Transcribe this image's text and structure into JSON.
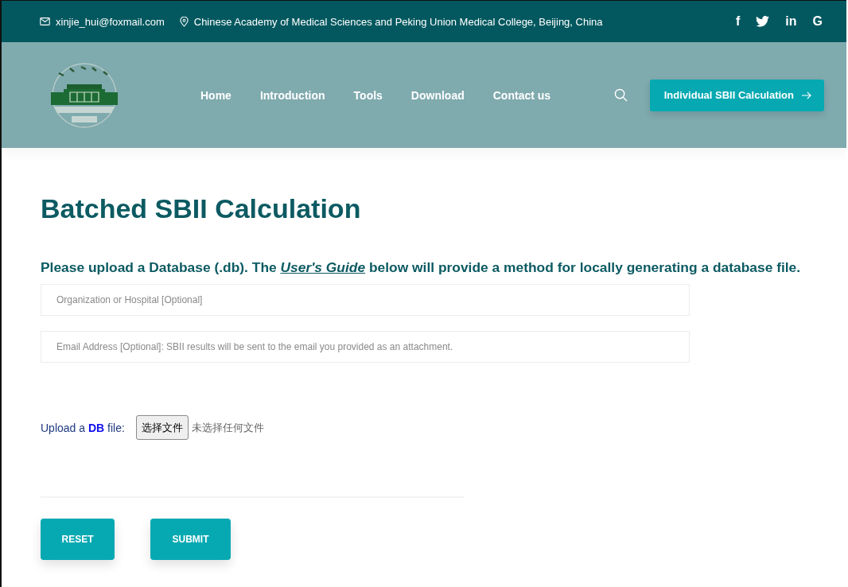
{
  "top_bar": {
    "email": "xinjie_hui@foxmail.com",
    "address": "Chinese Academy of Medical Sciences and Peking Union Medical College, Beijing, China",
    "social": [
      {
        "kind": "text",
        "label": "f"
      },
      {
        "kind": "bird"
      },
      {
        "kind": "text",
        "label": "in"
      },
      {
        "kind": "text",
        "label": "G"
      }
    ]
  },
  "nav": {
    "items": [
      "Home",
      "Introduction",
      "Tools",
      "Download",
      "Contact us"
    ],
    "cta": "Individual SBII Calculation"
  },
  "page": {
    "title": "Batched SBII Calculation",
    "intro": {
      "before": "Please upload a Database (.db). The ",
      "link": "User's Guide",
      "after": " below will provide a method for locally generating a database file."
    },
    "fields": [
      {
        "placeholder": "Organization or Hospital [Optional]"
      },
      {
        "placeholder": "Email Address [Optional]: SBII results will be sent to the email you provided as an attachment."
      }
    ],
    "upload": {
      "label": "Upload a **DB** file:",
      "button": "选择文件",
      "status": "未选择任何文件"
    },
    "buttons": [
      "RESET",
      "SUBMIT"
    ]
  }
}
